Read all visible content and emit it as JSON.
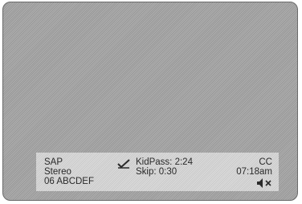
{
  "banner": {
    "audio_mode": "SAP",
    "audio_channel": "Stereo",
    "channel_label": "06 ABCDEF",
    "kidpass_text": "KidPass: 2:24",
    "skip_text": "Skip: 0:30",
    "cc_label": "CC",
    "time": "07:18am",
    "icons": {
      "kidpass": "checkmark-icon",
      "mute": "speaker-muted-icon"
    }
  }
}
